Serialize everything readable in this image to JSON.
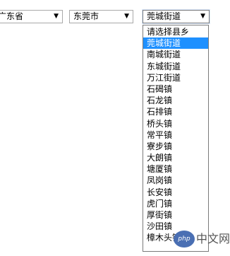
{
  "province_select": {
    "value": "广东省"
  },
  "city_select": {
    "value": "东莞市"
  },
  "district_select": {
    "value": "莞城街道"
  },
  "dropdown": {
    "options": [
      "请选择县乡",
      "莞城街道",
      "南城街道",
      "东城街道",
      "万江街道",
      "石碣镇",
      "石龙镇",
      "石排镇",
      "桥头镇",
      "常平镇",
      "寮步镇",
      "大朗镇",
      "塘厦镇",
      "凤岗镇",
      "长安镇",
      "虎门镇",
      "厚街镇",
      "沙田镇",
      "樟木头镇"
    ],
    "selected_index": 1,
    "highlight_color": "#1e90ff"
  },
  "watermark": {
    "logo_text": "php",
    "site_text": "中文网"
  },
  "icons": {
    "dropdown_arrow": "▼"
  }
}
